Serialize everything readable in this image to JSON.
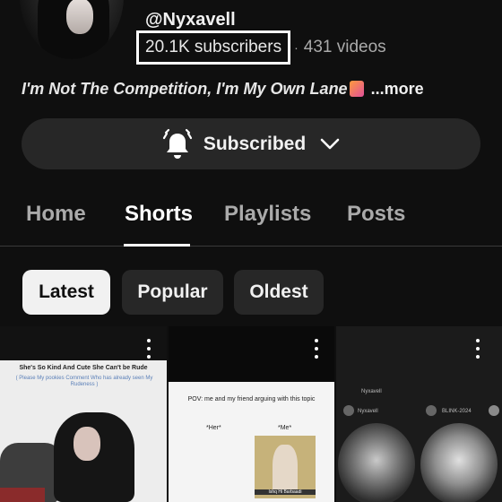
{
  "channel": {
    "handle": "@Nyxavell",
    "subscribers": "20.1K subscribers",
    "separator": "·",
    "videos": "431 videos",
    "bio": "I'm Not The Competition, I'm My Own Lane",
    "bio_more": "...more"
  },
  "subscribe_button": {
    "label": "Subscribed",
    "bell_icon": "bell-icon",
    "chevron_icon": "chevron-down-icon"
  },
  "tabs": [
    {
      "label": "Home",
      "active": false
    },
    {
      "label": "Shorts",
      "active": true
    },
    {
      "label": "Playlists",
      "active": false
    },
    {
      "label": "Posts",
      "active": false
    }
  ],
  "filters": [
    {
      "label": "Latest",
      "selected": true
    },
    {
      "label": "Popular",
      "selected": false
    },
    {
      "label": "Oldest",
      "selected": false
    }
  ],
  "shorts": [
    {
      "caption": "She's So Kind And Cute She Can't be Rude",
      "subcaption": "( Please My pookies Comment Who has already seen My Rudeness )"
    },
    {
      "caption": "POV: me and my friend arguing with this topic",
      "label_left": "*Her*",
      "label_right": "*Me*",
      "photo_caption": "Ishq Hi Barbaadi"
    },
    {
      "name_top": "Nyxavell",
      "name_left": "Nyxavell",
      "name_right": "BLINK-2024"
    }
  ],
  "colors": {
    "background": "#0f0f0f",
    "button_bg": "#272727",
    "chip_selected": "#f1f1f1",
    "text_secondary": "#aaaaaa"
  }
}
